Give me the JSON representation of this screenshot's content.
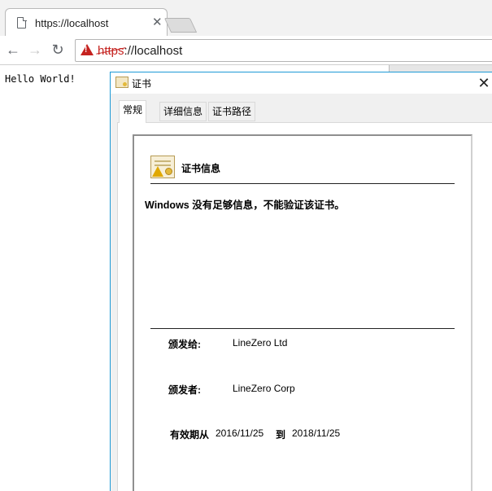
{
  "browser": {
    "tab_title": "https://localhost",
    "url_scheme": "https",
    "url_rest": "://localhost"
  },
  "page": {
    "body_text": "Hello World!"
  },
  "dialog": {
    "title": "证书",
    "tabs": [
      {
        "label": "常规",
        "active": true
      },
      {
        "label": "详细信息",
        "active": false
      },
      {
        "label": "证书路径",
        "active": false
      }
    ],
    "info_title": "证书信息",
    "warning": "Windows 没有足够信息，不能验证该证书。",
    "issued_to_label": "颁发给:",
    "issued_to_value": "LineZero Ltd",
    "issued_by_label": "颁发者:",
    "issued_by_value": "LineZero Corp",
    "valid_label": "有效期从",
    "valid_from": "2016/11/25",
    "valid_to_label": "到",
    "valid_to": "2018/11/25"
  },
  "colors": {
    "warning_red": "#c5221f",
    "dialog_border": "#1d9ad6"
  }
}
